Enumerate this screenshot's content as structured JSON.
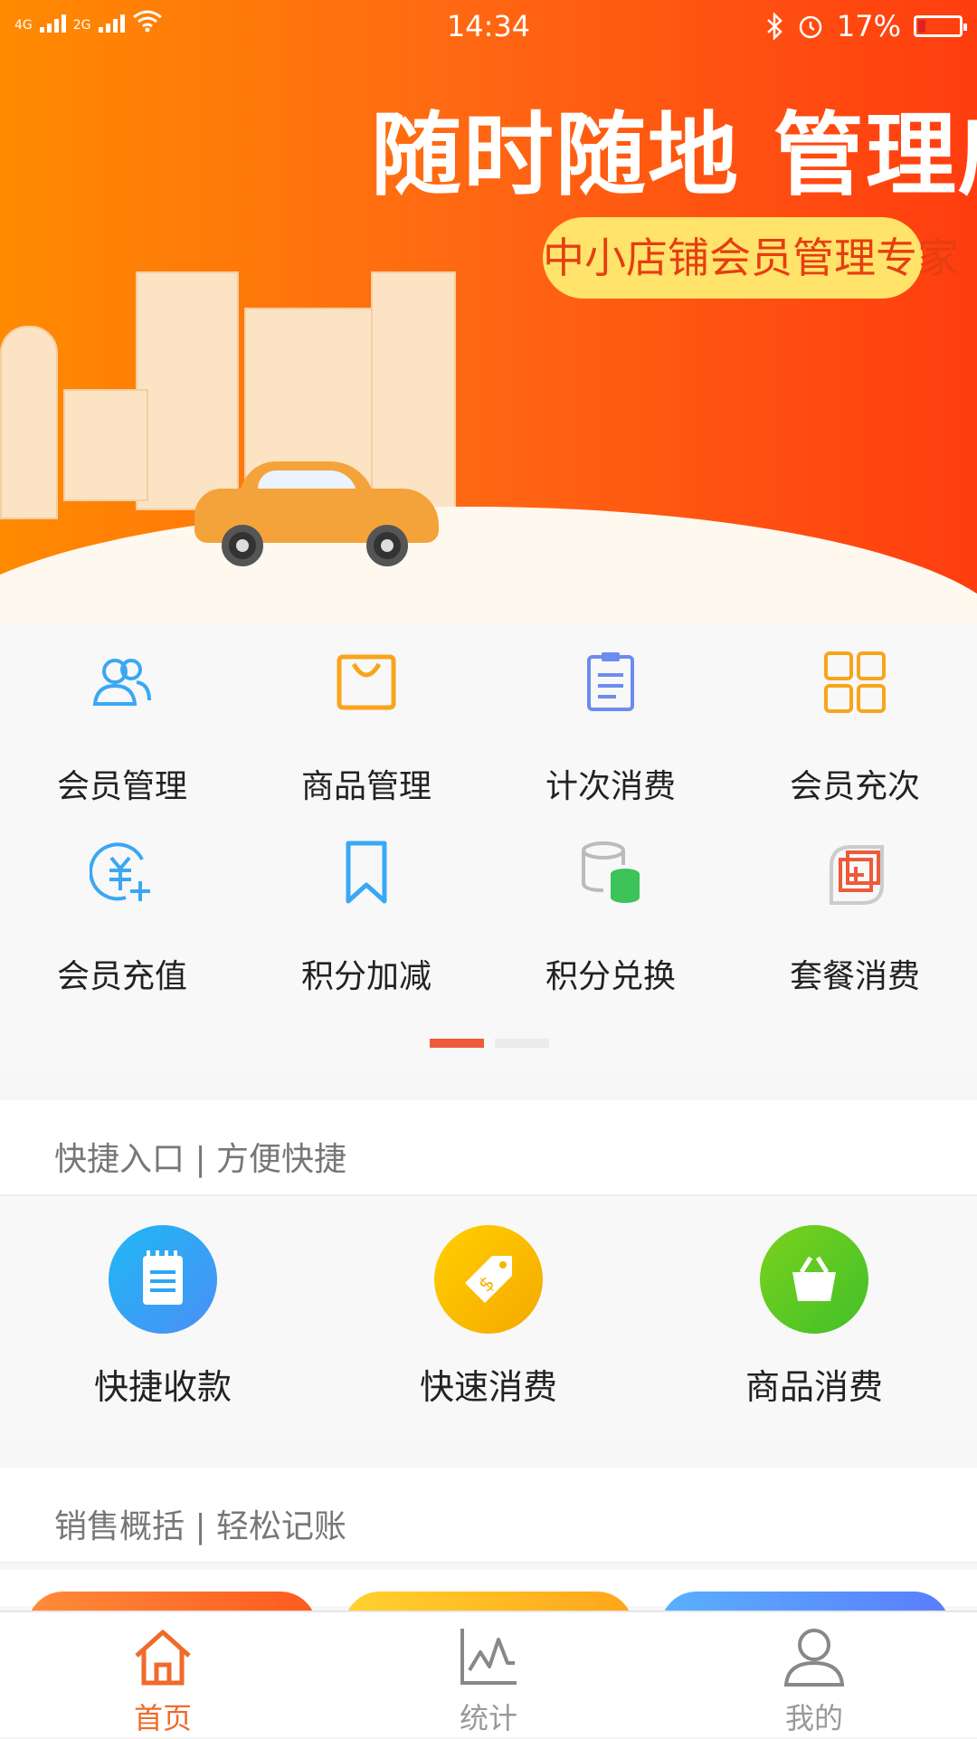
{
  "status_bar": {
    "net1": "4G",
    "net2": "2G",
    "time": "14:34",
    "battery_text": "17%"
  },
  "banner": {
    "title": "随时随地 管理店铺",
    "subtitle": "中小店铺会员管理专家"
  },
  "menu": {
    "items": [
      {
        "label": "会员管理",
        "icon": "members-icon"
      },
      {
        "label": "商品管理",
        "icon": "shopping-bag-icon"
      },
      {
        "label": "计次消费",
        "icon": "clipboard-icon"
      },
      {
        "label": "会员充次",
        "icon": "grid-icon"
      },
      {
        "label": "会员充值",
        "icon": "yuan-plus-icon"
      },
      {
        "label": "积分加减",
        "icon": "bookmark-icon"
      },
      {
        "label": "积分兑换",
        "icon": "coins-stack-icon"
      },
      {
        "label": "套餐消费",
        "icon": "package-plus-icon"
      }
    ],
    "page_indicator": {
      "current": 1,
      "total": 2
    }
  },
  "quick_entry": {
    "header": "快捷入口 | 方便快捷",
    "items": [
      {
        "label": "快捷收款",
        "icon": "notepad-icon",
        "color": "#2aa7f5"
      },
      {
        "label": "快速消费",
        "icon": "price-tag-icon",
        "color": "#f9b400"
      },
      {
        "label": "商品消费",
        "icon": "basket-icon",
        "color": "#5fce1e"
      }
    ]
  },
  "sales": {
    "header": "销售概括 | 轻松记账",
    "card_colors": [
      "#ff6f2f",
      "#ffb31a",
      "#5a8dff"
    ]
  },
  "tabbar": {
    "tabs": [
      {
        "label": "首页",
        "icon": "home-icon",
        "active": true
      },
      {
        "label": "统计",
        "icon": "chart-icon",
        "active": false
      },
      {
        "label": "我的",
        "icon": "user-icon",
        "active": false
      }
    ],
    "active_color": "#f06a2b"
  }
}
